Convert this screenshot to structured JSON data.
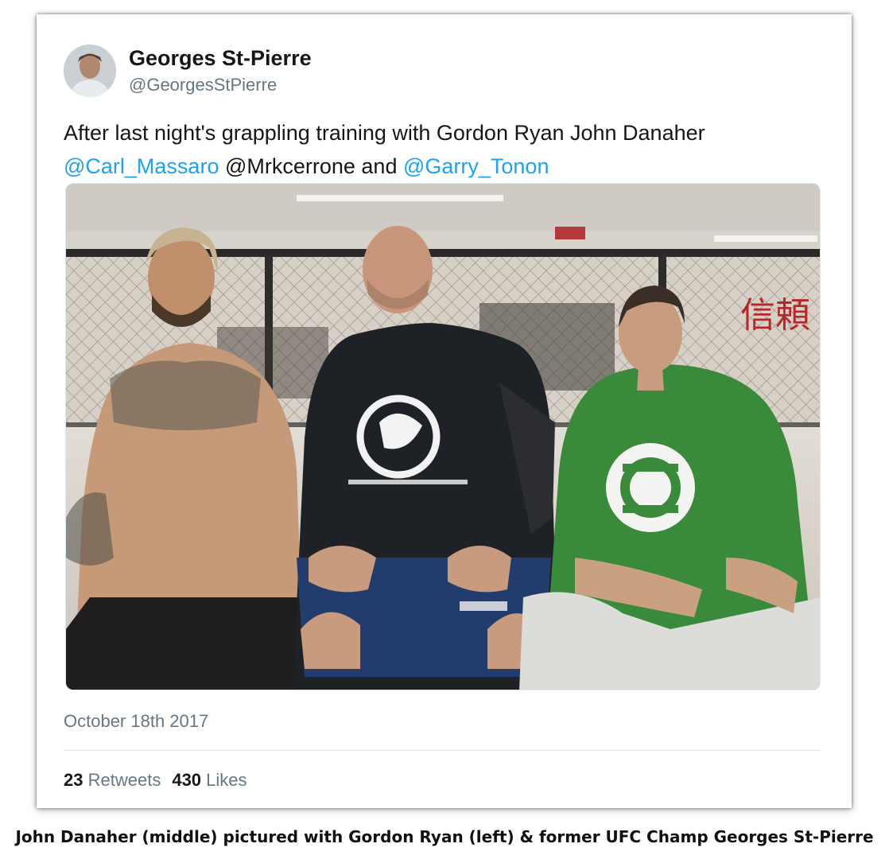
{
  "tweet": {
    "author": {
      "display_name": "Georges St-Pierre",
      "handle": "@GeorgesStPierre"
    },
    "text": {
      "part1": "After last night's grappling training with Gordon Ryan John Danaher ",
      "mention1": "@Carl_Massaro",
      "part2": " @Mrkcerrone and ",
      "mention2": "@Garry_Tonon"
    },
    "photo": {
      "banner_text": "信頼"
    },
    "date": "October 18th 2017",
    "stats": {
      "retweets_count": "23",
      "retweets_label": "Retweets",
      "likes_count": "430",
      "likes_label": "Likes"
    }
  },
  "caption": "John Danaher (middle) pictured with Gordon Ryan (left) & former UFC Champ Georges St-Pierre",
  "colors": {
    "link": "#1da1f2",
    "text": "#14171a",
    "muted": "#657786"
  }
}
